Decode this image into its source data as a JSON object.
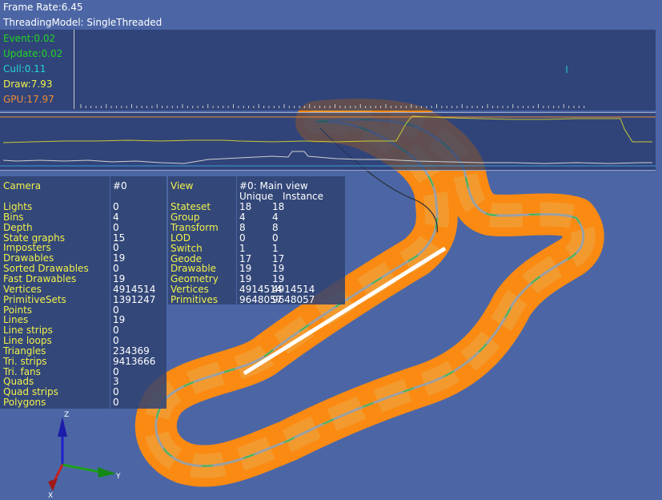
{
  "hud": {
    "frame_rate": "Frame Rate:6.45",
    "threading_model": "ThreadingModel: SingleThreaded"
  },
  "timing": [
    {
      "label": "Event:0.02",
      "color": "#23d223"
    },
    {
      "label": "Update:0.02",
      "color": "#23d223"
    },
    {
      "label": "Cull:0.11",
      "color": "#26d6d6"
    },
    {
      "label": "Draw:7.93",
      "color": "#f1f14a"
    },
    {
      "label": "GPU:17.97",
      "color": "#f08a35"
    }
  ],
  "camera_stats": {
    "header": {
      "label": "Camera",
      "value": "#0"
    },
    "rows": [
      {
        "label": "Lights",
        "value": "0"
      },
      {
        "label": "Bins",
        "value": "4"
      },
      {
        "label": "Depth",
        "value": "0"
      },
      {
        "label": "State graphs",
        "value": "15"
      },
      {
        "label": "Imposters",
        "value": "0"
      },
      {
        "label": "Drawables",
        "value": "19"
      },
      {
        "label": "Sorted Drawables",
        "value": "0"
      },
      {
        "label": "Fast Drawables",
        "value": "19"
      },
      {
        "label": "Vertices",
        "value": "4914514"
      },
      {
        "label": "PrimitiveSets",
        "value": "1391247"
      },
      {
        "label": "Points",
        "value": "0"
      },
      {
        "label": "Lines",
        "value": "19"
      },
      {
        "label": "Line strips",
        "value": "0"
      },
      {
        "label": "Line loops",
        "value": "0"
      },
      {
        "label": "Triangles",
        "value": "234369"
      },
      {
        "label": "Tri. strips",
        "value": "9413666"
      },
      {
        "label": "Tri. fans",
        "value": "0"
      },
      {
        "label": "Quads",
        "value": "3"
      },
      {
        "label": "Quad strips",
        "value": "0"
      },
      {
        "label": "Polygons",
        "value": "0"
      }
    ]
  },
  "view_stats": {
    "header": {
      "label": "View",
      "value": "#0: Main view"
    },
    "columns": {
      "unique": "Unique",
      "instance": "Instance"
    },
    "rows": [
      {
        "label": "Stateset",
        "unique": "18",
        "instance": "18"
      },
      {
        "label": "Group",
        "unique": "4",
        "instance": "4"
      },
      {
        "label": "Transform",
        "unique": "8",
        "instance": "8"
      },
      {
        "label": "LOD",
        "unique": "0",
        "instance": "0"
      },
      {
        "label": "Switch",
        "unique": "1",
        "instance": "1"
      },
      {
        "label": "Geode",
        "unique": "17",
        "instance": "17"
      },
      {
        "label": "Drawable",
        "unique": "19",
        "instance": "19"
      },
      {
        "label": "Geometry",
        "unique": "19",
        "instance": "19"
      },
      {
        "label": "Vertices",
        "unique": "4914514",
        "instance": "4914514"
      },
      {
        "label": "Primitives",
        "unique": "9648057",
        "instance": "9648057"
      }
    ]
  },
  "axes": {
    "x": "X",
    "y": "Y",
    "z": "Z"
  },
  "colors": {
    "background": "#4c66a5",
    "terrain": "#fb8a12",
    "track": "#9aa0a4",
    "label_yellow": "#f1f14a"
  }
}
